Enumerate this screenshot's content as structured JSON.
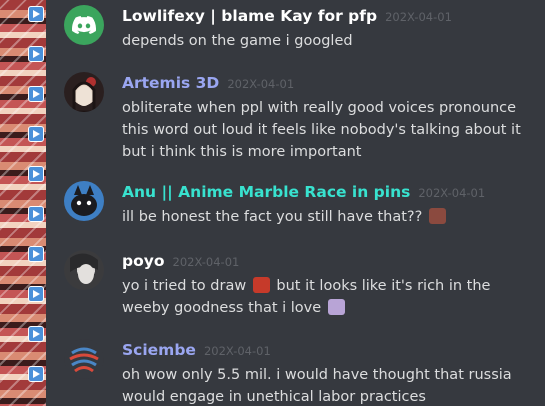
{
  "messages": [
    {
      "username": "Lowlifexy | blame Kay for pfp",
      "timestamp": "202X-04-01",
      "content": "depends on the game i googled",
      "avatar": "discord-logo-icon"
    },
    {
      "username": "Artemis 3D",
      "timestamp": "202X-04-01",
      "content": "obliterate when ppl with really good voices pronounce this word out loud it feels like nobody's talking about it but i think this is more important",
      "avatar": "artemis-avatar"
    },
    {
      "username": "Anu || Anime Marble Race in pins",
      "timestamp": "202X-04-01",
      "content": "ill be honest the fact you still have that??",
      "avatar": "anu-avatar",
      "emoji": "custom-emoji"
    },
    {
      "username": "poyo",
      "timestamp": "202X-04-01",
      "content_before": "yo i tried to draw",
      "content_after": "but it looks like it's rich in the weeby goodness that i love",
      "avatar": "poyo-avatar"
    },
    {
      "username": "Sciembe",
      "timestamp": "202X-04-01",
      "content": "oh wow only 5.5 mil. i would have thought that russia would engage in unethical labor practices",
      "avatar": "sciembe-avatar"
    }
  ],
  "colors": {
    "background": "#36393f",
    "username_white": "#ffffff",
    "username_purple": "#9aa6f1",
    "username_teal": "#38e2cf",
    "text": "#dcddde",
    "timestamp": "#5f6268"
  }
}
